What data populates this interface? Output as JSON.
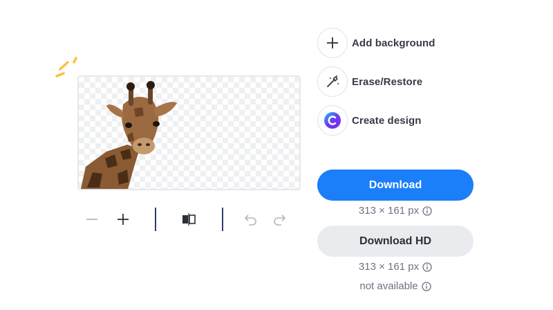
{
  "actions": [
    {
      "label": "Add background",
      "icon": "plus-icon"
    },
    {
      "label": "Erase/Restore",
      "icon": "magic-wand-icon"
    },
    {
      "label": "Create design",
      "icon": "canva-logo-icon"
    }
  ],
  "download": {
    "label": "Download",
    "size": "313 × 161 px",
    "color": "#1a7ff9"
  },
  "download_hd": {
    "label": "Download HD",
    "size": "313 × 161 px",
    "availability": "not available"
  },
  "toolbar": {
    "tools": [
      "zoom-out-icon",
      "zoom-in-icon",
      "flip-icon",
      "undo-icon",
      "redo-icon"
    ]
  },
  "preview": {
    "image": "giraffe with transparent background"
  }
}
